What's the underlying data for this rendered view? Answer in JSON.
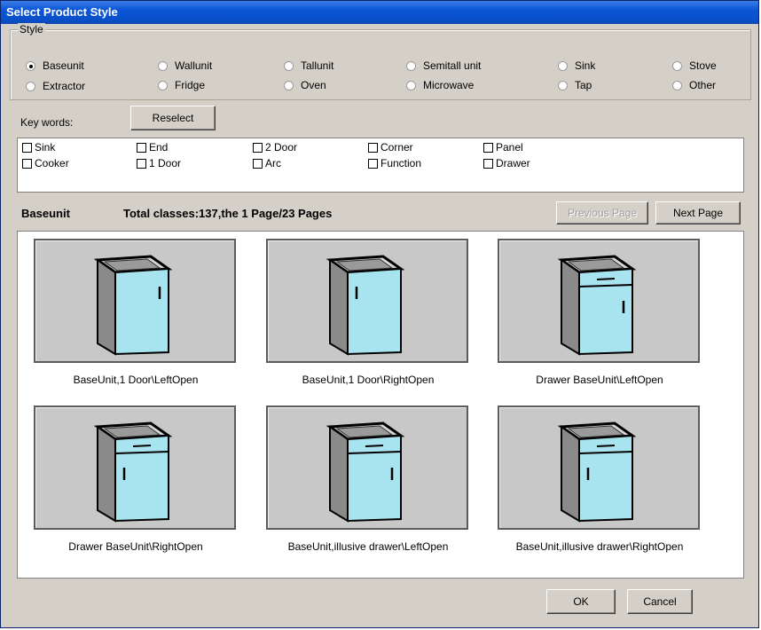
{
  "window": {
    "title": "Select Product Style"
  },
  "style_group": {
    "label": "Style",
    "options": [
      {
        "label": "Baseunit",
        "checked": true
      },
      {
        "label": "Wallunit",
        "checked": false
      },
      {
        "label": "Tallunit",
        "checked": false
      },
      {
        "label": "Semitall unit",
        "checked": false
      },
      {
        "label": "Sink",
        "checked": false
      },
      {
        "label": "Stove",
        "checked": false
      },
      {
        "label": "Extractor",
        "checked": false
      },
      {
        "label": "Fridge",
        "checked": false
      },
      {
        "label": "Oven",
        "checked": false
      },
      {
        "label": "Microwave",
        "checked": false
      },
      {
        "label": "Tap",
        "checked": false
      },
      {
        "label": "Other",
        "checked": false
      }
    ]
  },
  "keywords": {
    "label": "Key words:",
    "reselect_label": "Reselect",
    "items": [
      "Sink",
      "End",
      "2 Door",
      "Corner",
      "Panel",
      "Cooker",
      "1 Door",
      "Arc",
      "Function",
      "Drawer"
    ]
  },
  "status": {
    "category": "Baseunit",
    "summary": "Total classes:137,the 1 Page/23 Pages",
    "prev_label": "Previous Page",
    "next_label": "Next Page"
  },
  "products": [
    {
      "caption": "BaseUnit,1 Door\\LeftOpen",
      "variant": "door-left"
    },
    {
      "caption": "BaseUnit,1 Door\\RightOpen",
      "variant": "door-right"
    },
    {
      "caption": "Drawer BaseUnit\\LeftOpen",
      "variant": "drawer-left"
    },
    {
      "caption": "Drawer BaseUnit\\RightOpen",
      "variant": "drawer-right"
    },
    {
      "caption": "BaseUnit,illusive drawer\\LeftOpen",
      "variant": "illusive-left"
    },
    {
      "caption": "BaseUnit,illusive drawer\\RightOpen",
      "variant": "illusive-right"
    }
  ],
  "footer": {
    "ok_label": "OK",
    "cancel_label": "Cancel"
  },
  "colors": {
    "front_panel": "#a8e4f0",
    "side_panel": "#8a8a8a",
    "thumb_bg": "#c8c8c8",
    "titlebar": "#0a4fc8"
  }
}
